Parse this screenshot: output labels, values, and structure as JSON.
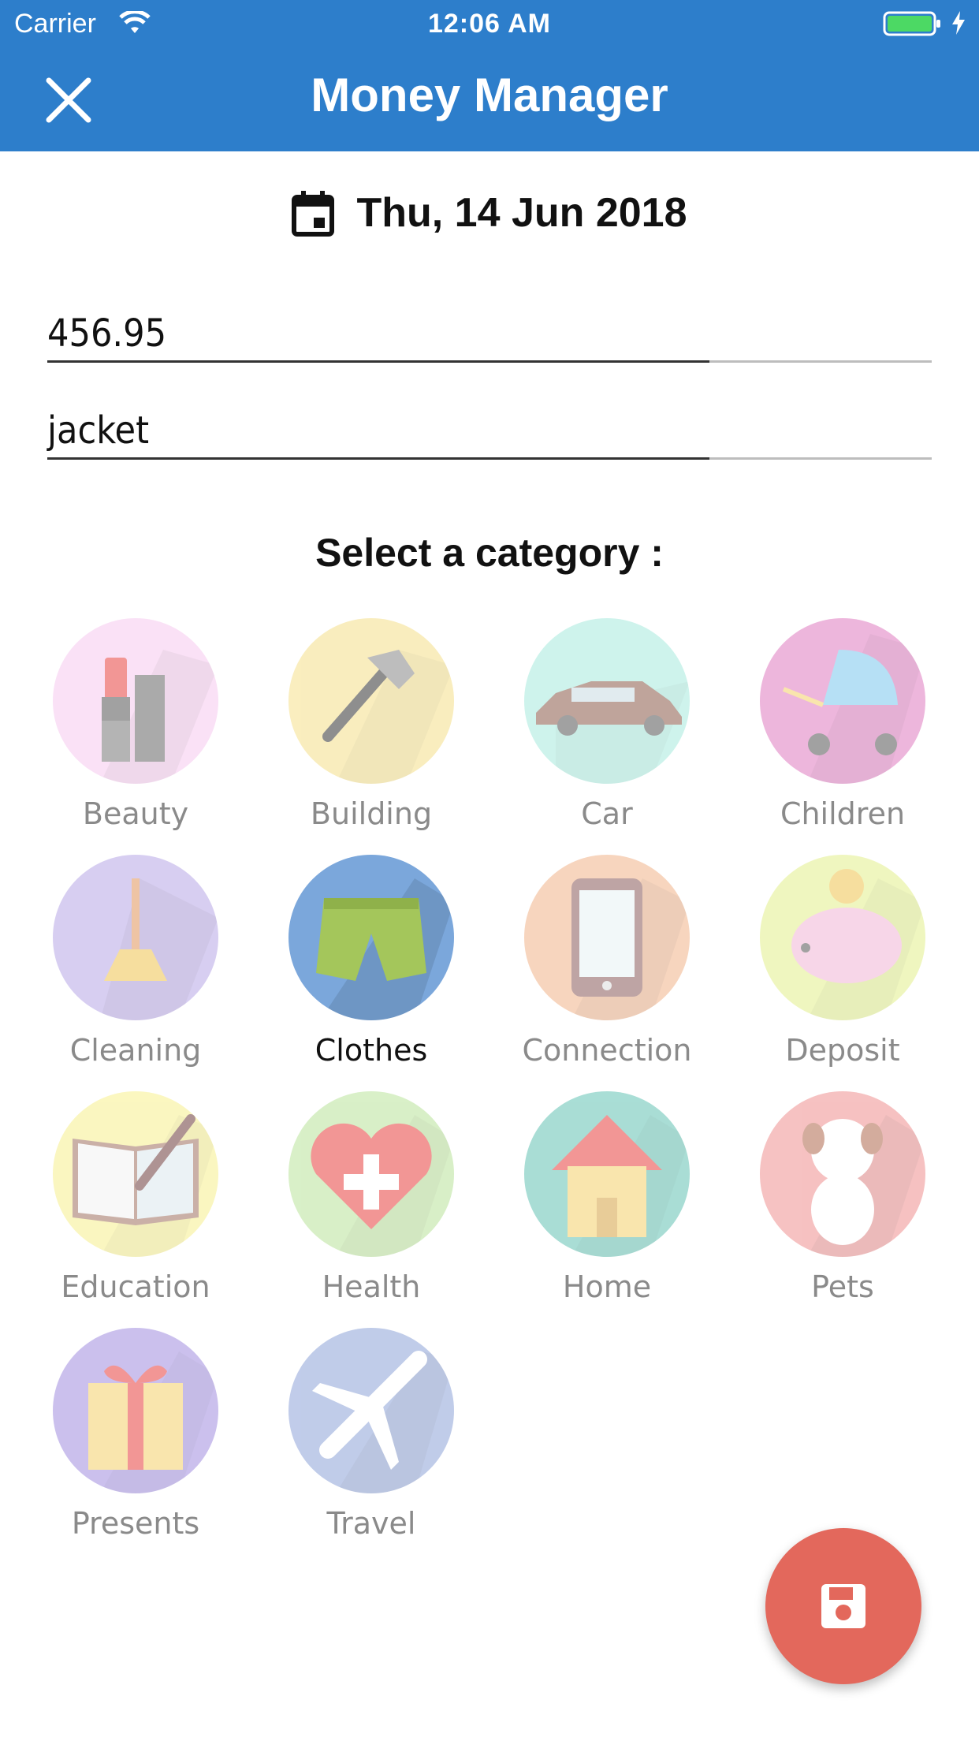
{
  "status": {
    "carrier": "Carrier",
    "time": "12:06 AM"
  },
  "header": {
    "title": "Money Manager"
  },
  "date": {
    "text": "Thu, 14 Jun 2018"
  },
  "form": {
    "amount": "456.95",
    "note": "jacket"
  },
  "section_title": "Select a category :",
  "categories": [
    {
      "label": "Beauty",
      "icon": "lipstick-icon",
      "color": "#f7c9ef"
    },
    {
      "label": "Building",
      "icon": "hammer-icon",
      "color": "#f5e08a"
    },
    {
      "label": "Car",
      "icon": "car-icon",
      "color": "#a7ebde"
    },
    {
      "label": "Children",
      "icon": "stroller-icon",
      "color": "#e07bc0"
    },
    {
      "label": "Cleaning",
      "icon": "broom-icon",
      "color": "#b7a7e6"
    },
    {
      "label": "Clothes",
      "icon": "shorts-icon",
      "color": "#7ba7db",
      "selected": true
    },
    {
      "label": "Connection",
      "icon": "phone-icon",
      "color": "#f2b48a"
    },
    {
      "label": "Deposit",
      "icon": "piggy-bank-icon",
      "color": "#e3f08b"
    },
    {
      "label": "Education",
      "icon": "book-pen-icon",
      "color": "#f7f08d"
    },
    {
      "label": "Health",
      "icon": "heart-plus-icon",
      "color": "#b9e39a"
    },
    {
      "label": "Home",
      "icon": "house-icon",
      "color": "#63c3b4"
    },
    {
      "label": "Pets",
      "icon": "dog-icon",
      "color": "#ef8f8f"
    },
    {
      "label": "Presents",
      "icon": "gift-icon",
      "color": "#a18ee0"
    },
    {
      "label": "Travel",
      "icon": "airplane-icon",
      "color": "#8ea3d8"
    }
  ],
  "fab": {
    "icon": "save-icon",
    "color": "#e3685c"
  }
}
